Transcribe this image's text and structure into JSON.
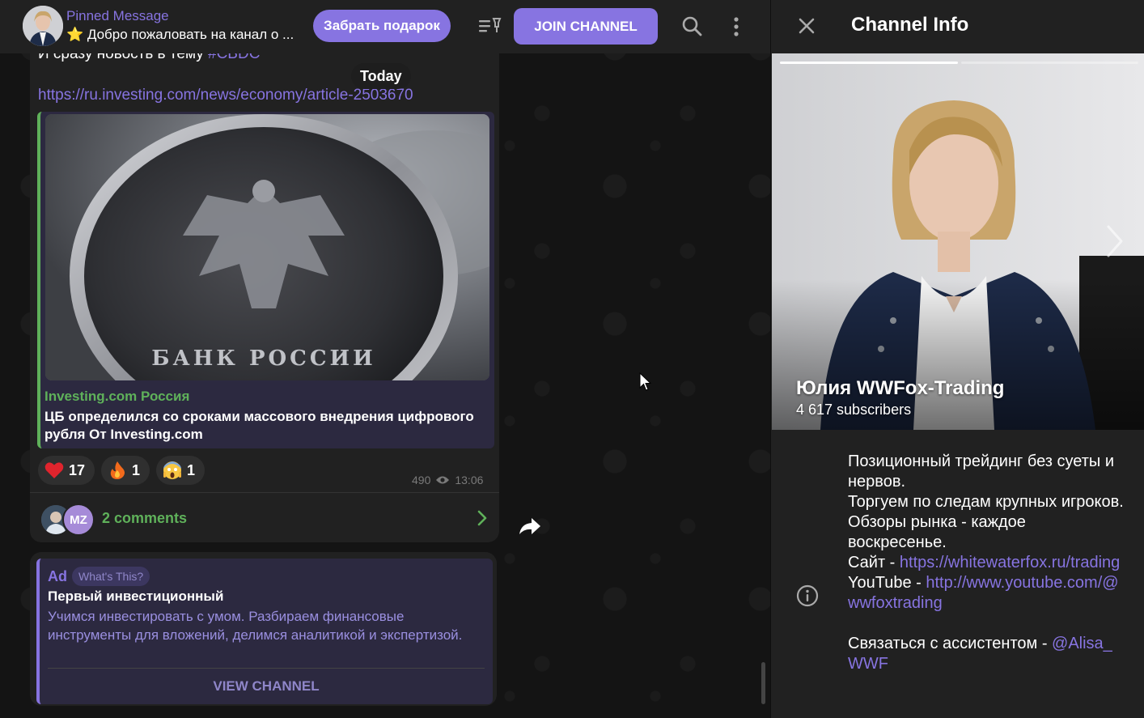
{
  "header": {
    "pinned_title": "Pinned Message",
    "pinned_text": "⭐ Добро пожаловать на канал о ...",
    "gift_button": "Забрать подарок",
    "join_button": "JOIN CHANNEL"
  },
  "message": {
    "snippet_text": "И сразу новость в тему ",
    "snippet_tag": "#CBDC",
    "date_badge": "Today",
    "link": "https://ru.investing.com/news/economy/article-2503670",
    "preview_site": "Investing.com Россия",
    "preview_title": "ЦБ определился со сроками массового внедрения цифрового рубля От Investing.com",
    "reactions": [
      {
        "emoji": "heart",
        "count": "17"
      },
      {
        "emoji": "fire",
        "count": "1"
      },
      {
        "emoji": "scream",
        "count": "1"
      }
    ],
    "views": "490",
    "time": "13:06",
    "comments_label": "2 comments",
    "commenter_initials": "MZ"
  },
  "ad": {
    "label": "Ad",
    "whats_this": "What's This?",
    "title": "Первый инвестиционный",
    "text": "Учимся инвестировать с умом. Разбираем финансовые инструменты для вложений, делимся аналитикой и экспертизой.",
    "button": "VIEW CHANNEL"
  },
  "panel": {
    "title": "Channel Info",
    "channel_name": "Юлия WWFox-Trading",
    "subscribers": "4 617 subscribers",
    "bio_lines": [
      "Позиционный трейдинг без суеты и нервов.",
      "Торгуем по следам крупных игроков.",
      "Обзоры рынка - каждое воскресенье."
    ],
    "site_label": "Сайт - ",
    "site_link": "https://whitewaterfox.ru/trading",
    "youtube_label": "YouTube - ",
    "youtube_link": "http://www.youtube.com/@wwfoxtrading",
    "contact_label": "Связаться с ассистентом - ",
    "contact_link": "@Alisa_WWF"
  },
  "colors": {
    "accent": "#8774e1",
    "green": "#5fb15a",
    "panel_bg": "#212121"
  }
}
